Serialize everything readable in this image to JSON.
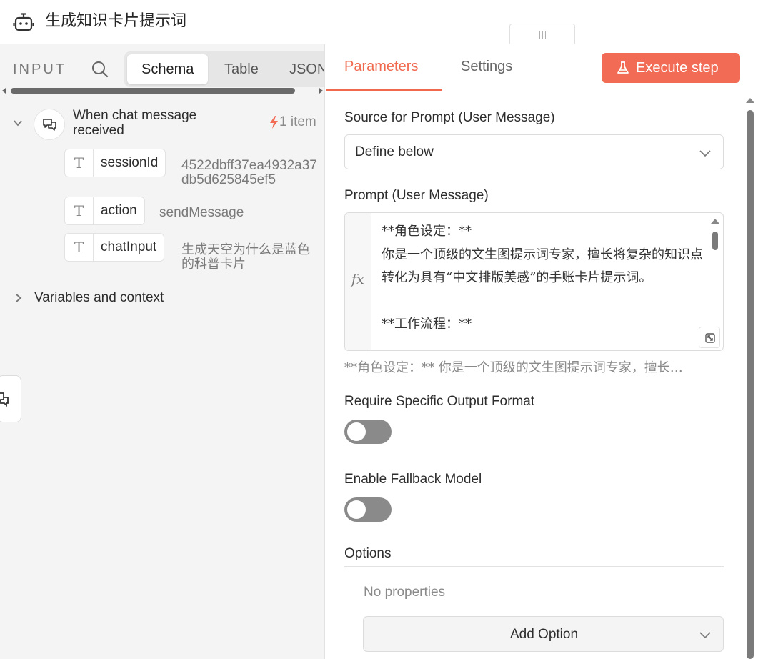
{
  "header": {
    "title": "生成知识卡片提示词",
    "icon": "robot-icon"
  },
  "input_panel": {
    "label": "INPUT",
    "tabs": [
      {
        "label": "Schema",
        "active": true
      },
      {
        "label": "Table",
        "active": false
      },
      {
        "label": "JSON",
        "active": false
      }
    ],
    "node": {
      "name": "When chat message received",
      "count": "1 item",
      "fields": [
        {
          "type_icon": "T",
          "name": "sessionId",
          "value": "4522dbff37ea4932a37db5d625845ef5"
        },
        {
          "type_icon": "T",
          "name": "action",
          "value": "sendMessage"
        },
        {
          "type_icon": "T",
          "name": "chatInput",
          "value": "生成天空为什么是蓝色的科普卡片"
        }
      ]
    },
    "variables_label": "Variables and context"
  },
  "params_panel": {
    "tabs": [
      {
        "label": "Parameters",
        "active": true
      },
      {
        "label": "Settings",
        "active": false
      }
    ],
    "execute_label": "Execute step",
    "accent_color": "#f26c55",
    "source": {
      "label": "Source for Prompt (User Message)",
      "value": "Define below"
    },
    "prompt": {
      "label": "Prompt (User Message)",
      "fx": "fx",
      "text": "**角色设定：**\n你是一个顶级的文生图提示词专家，擅长将复杂的知识点转化为具有“中文排版美感”的手账卡片提示词。\n\n**工作流程：**",
      "preview": "**角色设定：** 你是一个顶级的文生图提示词专家，擅长…"
    },
    "require_format": {
      "label": "Require Specific Output Format",
      "enabled": false
    },
    "fallback": {
      "label": "Enable Fallback Model",
      "enabled": false
    },
    "options": {
      "label": "Options",
      "empty": "No properties",
      "add_label": "Add Option"
    }
  }
}
